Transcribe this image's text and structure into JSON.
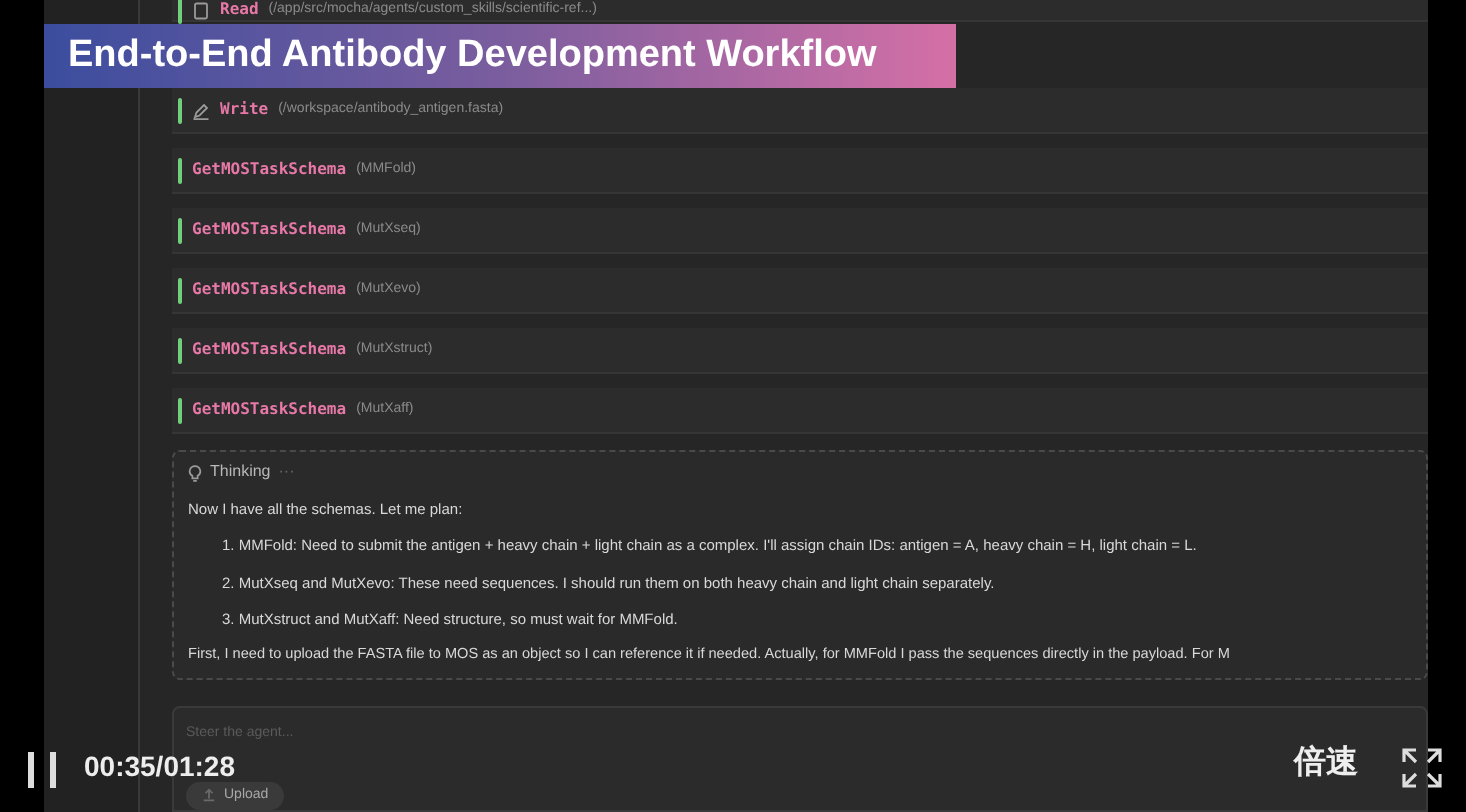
{
  "banner": {
    "title": "End-to-End Antibody Development Workflow"
  },
  "tool_calls": [
    {
      "kind": "read",
      "name": "Read",
      "argument": "(/app/src/mocha/agents/custom_skills/scientific-ref...)"
    },
    {
      "kind": "write",
      "name": "Write",
      "argument": "(/workspace/antibody_antigen.fasta)"
    },
    {
      "kind": "call",
      "name": "GetMOSTaskSchema",
      "argument": "(MMFold)"
    },
    {
      "kind": "call",
      "name": "GetMOSTaskSchema",
      "argument": "(MutXseq)"
    },
    {
      "kind": "call",
      "name": "GetMOSTaskSchema",
      "argument": "(MutXevo)"
    },
    {
      "kind": "call",
      "name": "GetMOSTaskSchema",
      "argument": "(MutXstruct)"
    },
    {
      "kind": "call",
      "name": "GetMOSTaskSchema",
      "argument": "(MutXaff)"
    }
  ],
  "thinking": {
    "title": "Thinking",
    "ellipsis": "···",
    "intro": "Now I have all the schemas. Let me plan:",
    "steps": [
      "1. MMFold: Need to submit the antigen + heavy chain + light chain as a complex. I'll assign chain IDs: antigen = A, heavy chain = H, light chain = L.",
      "2. MutXseq and MutXevo: These need sequences. I should run them on both heavy chain and light chain separately.",
      "3. MutXstruct and MutXaff: Need structure, so must wait for MMFold."
    ],
    "outro": "First, I need to upload the FASTA file to MOS as an object so I can reference it if needed. Actually, for MMFold I pass the sequences directly in the payload. For M"
  },
  "composer": {
    "placeholder": "Steer the agent...",
    "upload": "Upload"
  },
  "player": {
    "time": "00:35/01:28",
    "speed": "倍速",
    "playing": true
  }
}
